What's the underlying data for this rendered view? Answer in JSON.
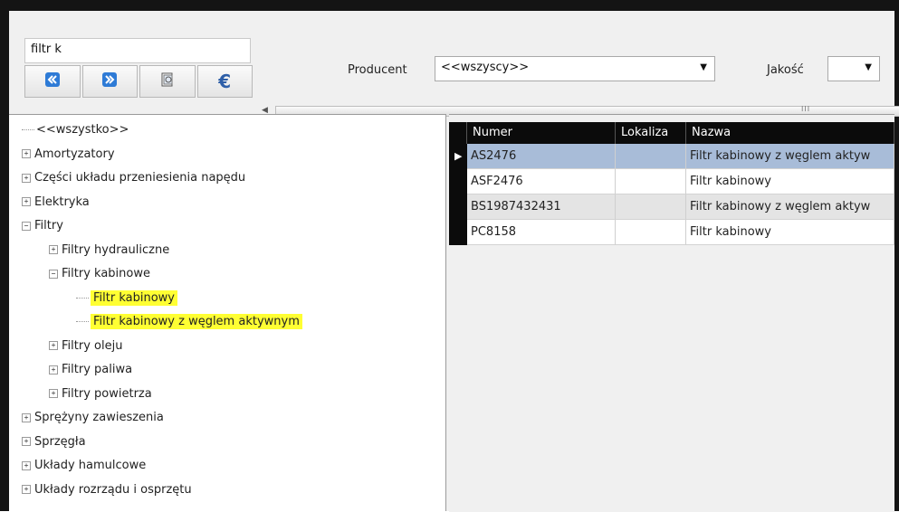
{
  "search": {
    "value": "filtr k"
  },
  "nav_buttons": [
    {
      "icon": "rewind-icon"
    },
    {
      "icon": "fast-forward-icon"
    },
    {
      "icon": "copy-icon"
    },
    {
      "icon": "euro-icon"
    }
  ],
  "filters": {
    "producent_label": "Producent",
    "producent_value": "<<wszyscy>>",
    "jakosc_label": "Jakość",
    "jakosc_value": ""
  },
  "scrollbar": {
    "grip": "III"
  },
  "tree": {
    "items": [
      {
        "label": "<<wszystko>>",
        "level": 0,
        "type": "root"
      },
      {
        "label": "Amortyzatory",
        "level": 0,
        "type": "collapsed"
      },
      {
        "label": "Części układu przeniesienia napędu",
        "level": 0,
        "type": "collapsed"
      },
      {
        "label": "Elektryka",
        "level": 0,
        "type": "collapsed"
      },
      {
        "label": "Filtry",
        "level": 0,
        "type": "expanded"
      },
      {
        "label": "Filtry hydrauliczne",
        "level": 1,
        "type": "collapsed"
      },
      {
        "label": "Filtry kabinowe",
        "level": 1,
        "type": "expanded"
      },
      {
        "label": "Filtr kabinowy",
        "level": 2,
        "type": "leaf",
        "highlight": true
      },
      {
        "label": "Filtr kabinowy z węglem aktywnym",
        "level": 2,
        "type": "leaf",
        "highlight": true
      },
      {
        "label": "Filtry oleju",
        "level": 1,
        "type": "collapsed"
      },
      {
        "label": "Filtry paliwa",
        "level": 1,
        "type": "collapsed"
      },
      {
        "label": "Filtry powietrza",
        "level": 1,
        "type": "collapsed"
      },
      {
        "label": "Sprężyny zawieszenia",
        "level": 0,
        "type": "collapsed"
      },
      {
        "label": "Sprzęgła",
        "level": 0,
        "type": "collapsed"
      },
      {
        "label": "Układy hamulcowe",
        "level": 0,
        "type": "collapsed"
      },
      {
        "label": "Układy rozrządu i osprzętu",
        "level": 0,
        "type": "collapsed"
      }
    ]
  },
  "grid": {
    "columns": [
      "Numer",
      "Lokaliza",
      "Nazwa"
    ],
    "rows": [
      {
        "numer": "AS2476",
        "lokalizacja": "",
        "nazwa": "Filtr kabinowy z węglem aktyw",
        "selected": true
      },
      {
        "numer": "ASF2476",
        "lokalizacja": "",
        "nazwa": "Filtr kabinowy",
        "selected": false
      },
      {
        "numer": "BS1987432431",
        "lokalizacja": "",
        "nazwa": "Filtr kabinowy z węglem aktyw",
        "selected": false
      },
      {
        "numer": "PC8158",
        "lokalizacja": "",
        "nazwa": "Filtr kabinowy",
        "selected": false
      }
    ],
    "colors": {
      "selected_row": "#a8bcd8",
      "alt_row": "#e4e4e4",
      "row": "#ffffff",
      "header": "#0b0b0b"
    }
  },
  "colors": {
    "highlight": "#ffff33",
    "border": "#141414"
  }
}
